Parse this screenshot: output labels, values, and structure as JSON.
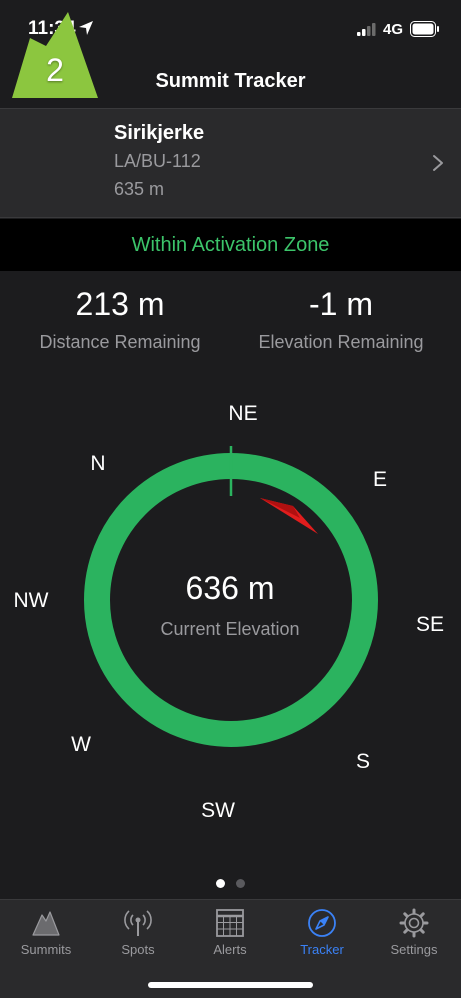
{
  "status_bar": {
    "time": "11:34",
    "network": "4G",
    "icons": [
      "location-arrow-icon",
      "signal-icon",
      "battery-icon"
    ]
  },
  "nav": {
    "title": "Summit Tracker"
  },
  "summit": {
    "points": "2",
    "name": "Sirikjerke",
    "reference": "LA/BU-112",
    "altitude": "635 m",
    "icon_color": "#8cc63f"
  },
  "zone": {
    "status": "Within Activation Zone",
    "color": "#3cc46a"
  },
  "stats": {
    "distance_value": "213 m",
    "distance_label": "Distance Remaining",
    "elevation_value": "-1 m",
    "elevation_label": "Elevation Remaining"
  },
  "compass": {
    "directions": {
      "n": "N",
      "ne": "NE",
      "e": "E",
      "se": "SE",
      "s": "S",
      "sw": "SW",
      "w": "W",
      "nw": "NW"
    },
    "ring_color": "#2bb35f",
    "pointer_color": "#e11d1d",
    "current_elevation": "636 m",
    "current_elevation_label": "Current Elevation"
  },
  "pager": {
    "active_index": 0,
    "count": 2
  },
  "tabs": [
    {
      "label": "Summits",
      "icon": "mountain-icon",
      "active": false
    },
    {
      "label": "Spots",
      "icon": "antenna-icon",
      "active": false
    },
    {
      "label": "Alerts",
      "icon": "calendar-icon",
      "active": false
    },
    {
      "label": "Tracker",
      "icon": "compass-icon",
      "active": true
    },
    {
      "label": "Settings",
      "icon": "gear-icon",
      "active": false
    }
  ]
}
